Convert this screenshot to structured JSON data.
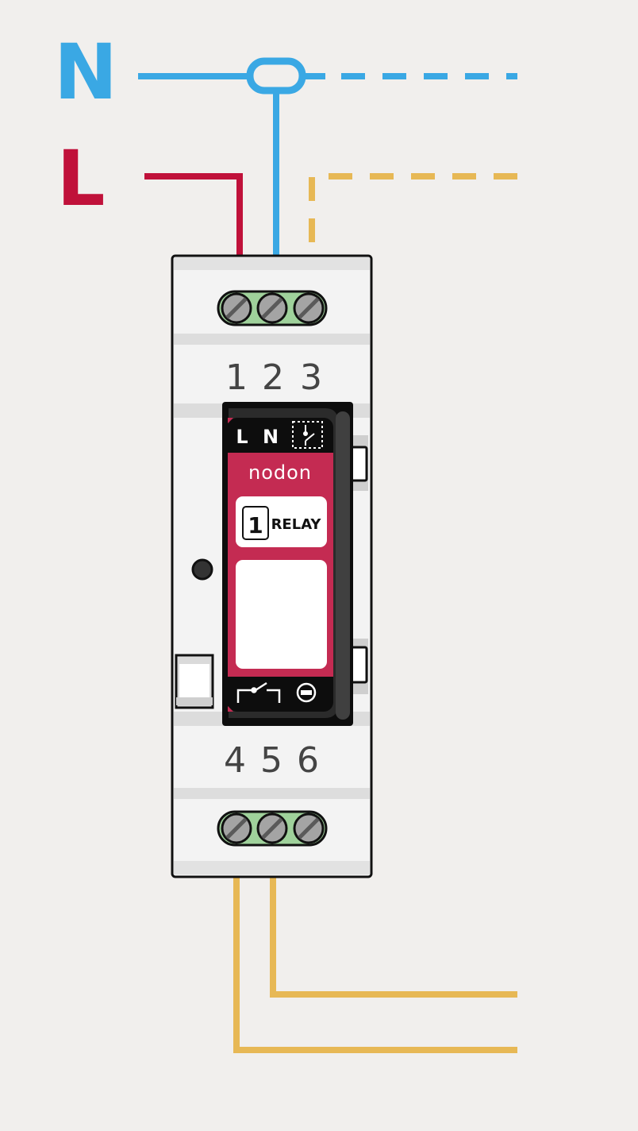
{
  "colors": {
    "neutral": "#3aa8e4",
    "live": "#c0113a",
    "load": "#e7b855",
    "background": "#f1efed",
    "module_body": "#f3f3f3",
    "module_band": "#dcdcdc",
    "terminal_green": "#9fd19b",
    "panel_red": "#c42b52",
    "panel_black": "#0d0d0d"
  },
  "wire_labels": {
    "neutral": "N",
    "live": "L"
  },
  "terminals": {
    "top": [
      "1",
      "2",
      "3"
    ],
    "bottom": [
      "4",
      "5",
      "6"
    ]
  },
  "panel": {
    "header_labels": [
      "L",
      "N"
    ],
    "brand": "nodon",
    "channel_number": "1",
    "product_label": "RELAY",
    "icons": [
      "switch-input-icon",
      "relay-contact-icon",
      "minus-circle-icon"
    ]
  }
}
